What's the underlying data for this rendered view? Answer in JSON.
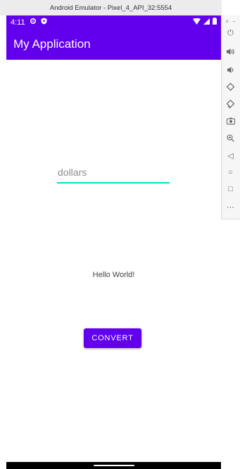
{
  "emulator": {
    "title": "Android Emulator - Pixel_4_API_32:5554",
    "side_close": "×",
    "side_min": "−",
    "tools": [
      {
        "icon": "power-icon",
        "glyph": "⏻"
      },
      {
        "icon": "volume-up-icon",
        "glyph": "🔊"
      },
      {
        "icon": "volume-down-icon",
        "glyph": "🔉"
      },
      {
        "icon": "rotate-left-icon",
        "glyph": "◇"
      },
      {
        "icon": "rotate-right-icon",
        "glyph": "◇"
      },
      {
        "icon": "camera-icon",
        "glyph": "▣"
      },
      {
        "icon": "zoom-icon",
        "glyph": "⊕"
      },
      {
        "icon": "back-icon",
        "glyph": "◁"
      },
      {
        "icon": "home-icon",
        "glyph": "○"
      },
      {
        "icon": "overview-icon",
        "glyph": "□"
      },
      {
        "icon": "more-icon",
        "glyph": "⋯"
      }
    ]
  },
  "status_bar": {
    "time": "4:11"
  },
  "app_bar": {
    "title": "My Application"
  },
  "main": {
    "dollars_placeholder": "dollars",
    "hello_text": "Hello World!",
    "convert_label": "CONVERT"
  },
  "colors": {
    "primary": "#6200ee",
    "accent": "#03dac5"
  }
}
